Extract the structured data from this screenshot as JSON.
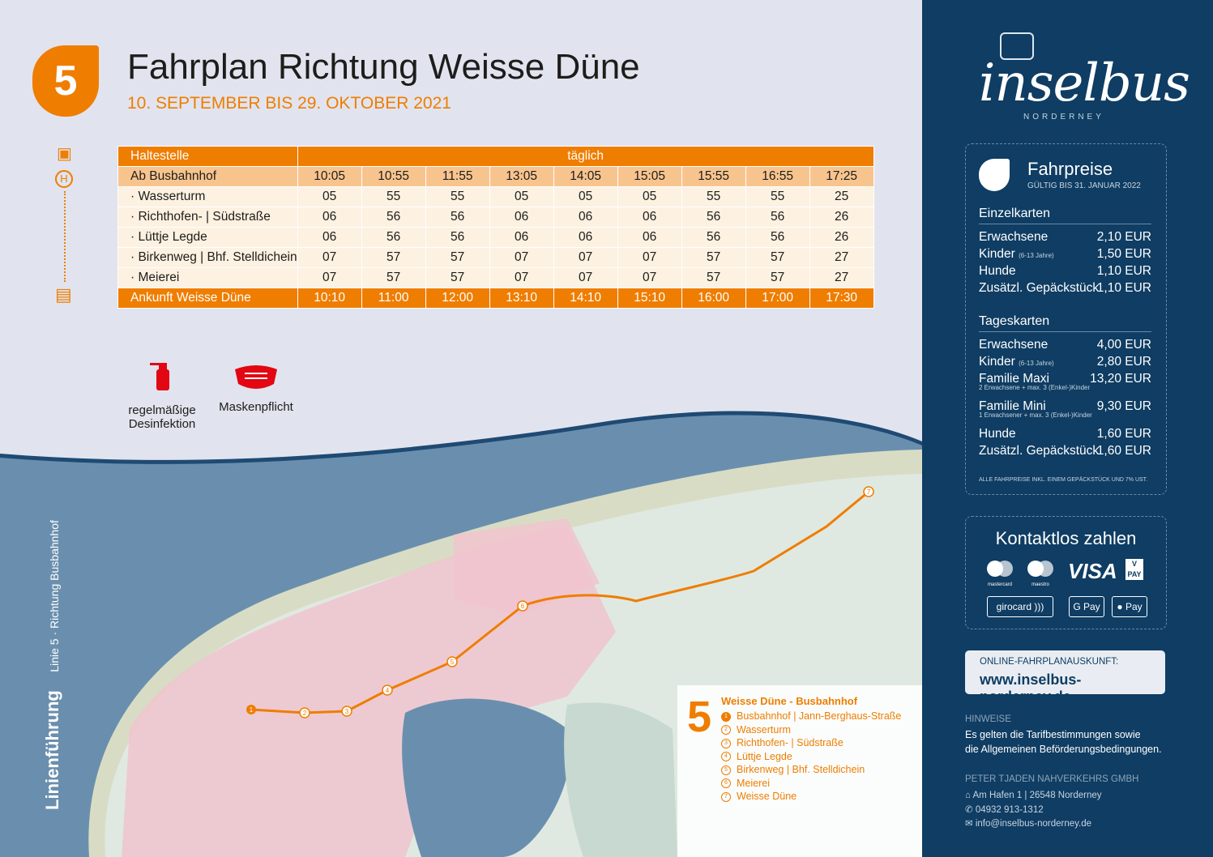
{
  "header": {
    "line_number": "5",
    "title": "Fahrplan Richtung Weisse Düne",
    "subtitle": "10. SEPTEMBER BIS 29. OKTOBER 2021"
  },
  "timetable": {
    "col_stop": "Haltestelle",
    "col_days": "täglich",
    "start_stop": "Ab Busbahnhof",
    "start_times": [
      "10:05",
      "10:55",
      "11:55",
      "13:05",
      "14:05",
      "15:05",
      "15:55",
      "16:55",
      "17:25"
    ],
    "rows": [
      {
        "stop": "· Wasserturm",
        "times": [
          "05",
          "55",
          "55",
          "05",
          "05",
          "05",
          "55",
          "55",
          "25"
        ]
      },
      {
        "stop": "· Richthofen- | Südstraße",
        "times": [
          "06",
          "56",
          "56",
          "06",
          "06",
          "06",
          "56",
          "56",
          "26"
        ]
      },
      {
        "stop": "· Lüttje Legde",
        "times": [
          "06",
          "56",
          "56",
          "06",
          "06",
          "06",
          "56",
          "56",
          "26"
        ]
      },
      {
        "stop": "· Birkenweg | Bhf. Stelldichein",
        "times": [
          "07",
          "57",
          "57",
          "07",
          "07",
          "07",
          "57",
          "57",
          "27"
        ]
      },
      {
        "stop": "· Meierei",
        "times": [
          "07",
          "57",
          "57",
          "07",
          "07",
          "07",
          "57",
          "57",
          "27"
        ]
      }
    ],
    "arrival_stop": "Ankunft Weisse Düne",
    "arrival_times": [
      "10:10",
      "11:00",
      "12:00",
      "13:10",
      "14:10",
      "15:10",
      "16:00",
      "17:00",
      "17:30"
    ]
  },
  "covid": {
    "disinfection": "regelmäßige Desinfektion",
    "mask": "Maskenpflicht"
  },
  "map": {
    "vertical_title": "Linienführung",
    "vertical_sub": "Linie 5 · Richtung Busbahnhof",
    "stop_numbers": [
      "1",
      "2",
      "3",
      "4",
      "5",
      "6",
      "7"
    ],
    "legend": {
      "line": "5",
      "title": "Weisse Düne - Busbahnhof",
      "stops": [
        "Busbahnhof | Jann-Berghaus-Straße",
        "Wasserturm",
        "Richthofen- | Südstraße",
        "Lüttje Legde",
        "Birkenweg | Bhf. Stelldichein",
        "Meierei",
        "Weisse Düne"
      ]
    }
  },
  "brand": {
    "logo": "inselbus",
    "logo_sub": "NORDERNEY"
  },
  "fares": {
    "title": "Fahrpreise",
    "valid": "GÜLTIG BIS 31. JANUAR 2022",
    "single_title": "Einzelkarten",
    "single": [
      {
        "label": "Erwachsene",
        "note": "",
        "value": "2,10 EUR"
      },
      {
        "label": "Kinder",
        "note": "(6-13 Jahre)",
        "value": "1,50 EUR"
      },
      {
        "label": "Hunde",
        "note": "",
        "value": "1,10 EUR"
      },
      {
        "label": "Zusätzl. Gepäckstück",
        "note": "",
        "value": "1,10 EUR"
      }
    ],
    "day_title": "Tageskarten",
    "day": [
      {
        "label": "Erwachsene",
        "note": "",
        "value": "4,00 EUR"
      },
      {
        "label": "Kinder",
        "note": "(6-13 Jahre)",
        "value": "2,80 EUR"
      },
      {
        "label": "Familie Maxi",
        "sub": "2 Erwachsene + max. 3 (Enkel-)Kinder",
        "value": "13,20 EUR"
      },
      {
        "label": "Familie Mini",
        "sub": "1 Erwachsener + max. 3 (Enkel-)Kinder",
        "value": "9,30 EUR"
      },
      {
        "label": "Hunde",
        "note": "",
        "value": "1,60 EUR"
      },
      {
        "label": "Zusätzl. Gepäckstück",
        "note": "",
        "value": "1,60 EUR"
      }
    ],
    "footnote": "ALLE FAHRPREISE INKL. EINEM GEPÄCKSTÜCK UND 7% UST."
  },
  "payment": {
    "title": "Kontaktlos zahlen",
    "methods": [
      "mastercard",
      "maestro",
      "VISA",
      "V PAY",
      "girocard",
      "G Pay",
      "Pay"
    ]
  },
  "online": {
    "label": "ONLINE-FAHRPLANAUSKUNFT:",
    "url": "www.inselbus-norderney.de"
  },
  "notes": {
    "heading": "HINWEISE",
    "line1": "Es gelten die Tarifbestimmungen sowie",
    "line2": "die Allgemeinen Beförderungsbedingungen."
  },
  "company": {
    "name": "PETER TJADEN NAHVERKEHRS GMBH",
    "address": "Am Hafen 1 | 26548 Norderney",
    "phone": "04932 913-1312",
    "email": "info@inselbus-norderney.de"
  },
  "colors": {
    "accent": "#ef7d00",
    "navy": "#0f3d63",
    "sea": "#6a8fae",
    "land": "#dfe9e1",
    "town": "#f0c4cf"
  }
}
